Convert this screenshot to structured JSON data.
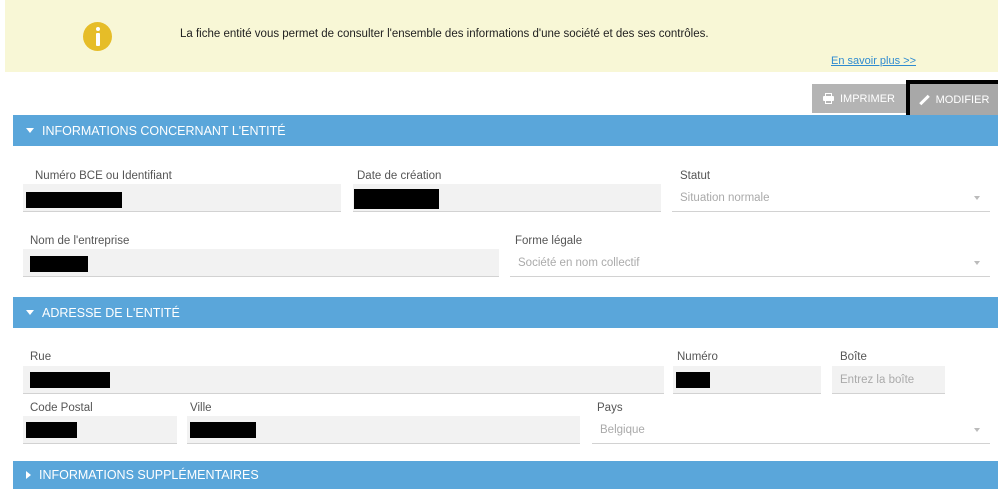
{
  "banner": {
    "text": "La fiche entité vous permet de consulter l'ensemble des informations d'une société et des ses contrôles.",
    "link": "En savoir plus >>"
  },
  "toolbar": {
    "print_label": "IMPRIMER",
    "edit_label": "MODIFIER"
  },
  "sections": {
    "entity": {
      "title": "INFORMATIONS CONCERNANT L'ENTITÉ",
      "bce_label": "Numéro BCE ou Identifiant",
      "created_label": "Date de création",
      "status_label": "Statut",
      "status_value": "Situation normale",
      "company_label": "Nom de l'entreprise",
      "legal_form_label": "Forme légale",
      "legal_form_value": "Société en nom collectif"
    },
    "address": {
      "title": "ADRESSE DE L'ENTITÉ",
      "street_label": "Rue",
      "number_label": "Numéro",
      "box_label": "Boîte",
      "box_placeholder": "Entrez la boîte",
      "postal_label": "Code Postal",
      "city_label": "Ville",
      "country_label": "Pays",
      "country_value": "Belgique"
    },
    "extra": {
      "title": "INFORMATIONS SUPPLÉMENTAIRES"
    }
  },
  "colors": {
    "accent": "#5aa6da",
    "banner_bg": "#f8f7d6",
    "info_icon": "#e6bd28",
    "link": "#2f8bd0"
  },
  "icons": {
    "info": "info-icon",
    "print": "print-icon",
    "edit": "pencil-icon",
    "expand": "caret-down-icon",
    "collapse": "caret-right-icon"
  }
}
